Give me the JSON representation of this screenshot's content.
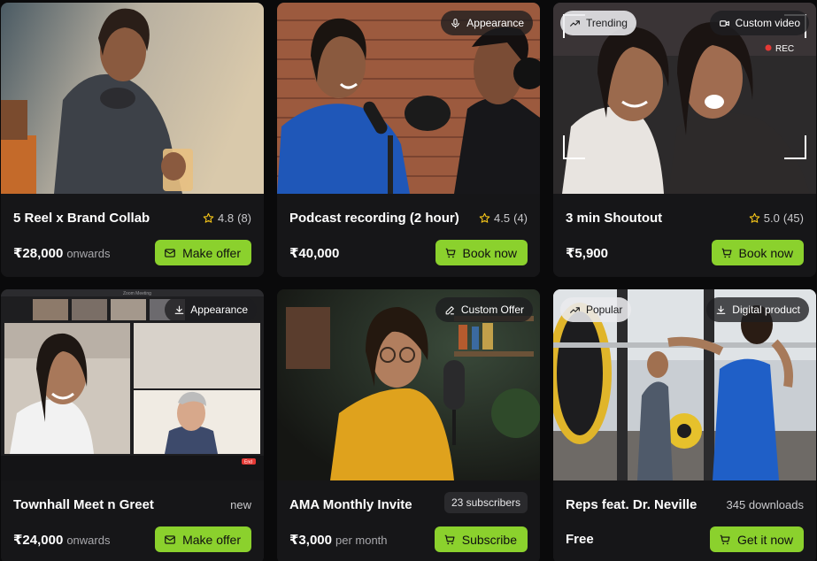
{
  "cards": [
    {
      "title": "5 Reel x Brand Collab",
      "rating": "4.8",
      "rating_count": "(8)",
      "price": "₹28,000",
      "price_suffix": "onwards",
      "cta": "Make offer",
      "cta_icon": "mail-icon"
    },
    {
      "title": "Podcast recording (2 hour)",
      "rating": "4.5",
      "rating_count": "(4)",
      "price": "₹40,000",
      "price_suffix": "",
      "cta": "Book now",
      "cta_icon": "cart-icon",
      "badge_right": "Appearance",
      "badge_right_icon": "mic-icon"
    },
    {
      "title": "3 min Shoutout",
      "rating": "5.0",
      "rating_count": "(45)",
      "price": "₹5,900",
      "price_suffix": "",
      "cta": "Book now",
      "cta_icon": "cart-icon",
      "badge_left": "Trending",
      "badge_left_icon": "trend-icon",
      "badge_right": "Custom video",
      "badge_right_icon": "video-icon",
      "rec_label": "REC"
    },
    {
      "title": "Townhall Meet n Greet",
      "meta": "new",
      "price": "₹24,000",
      "price_suffix": "onwards",
      "cta": "Make offer",
      "cta_icon": "mail-icon",
      "badge_right": "Appearance",
      "badge_right_icon": "download-icon",
      "zoom_title": "Zoom Meeting",
      "zoom_end": "End"
    },
    {
      "title": "AMA Monthly Invite",
      "meta_pill": "23 subscribers",
      "price": "₹3,000",
      "price_suffix": "per month",
      "cta": "Subscribe",
      "cta_icon": "cart-icon",
      "badge_right": "Custom Offer",
      "badge_right_icon": "pen-icon"
    },
    {
      "title": "Reps feat. Dr. Neville",
      "meta": "345 downloads",
      "price": "Free",
      "price_suffix": "",
      "cta": "Get it now",
      "cta_icon": "cart-icon",
      "badge_left": "Popular",
      "badge_left_icon": "trend-icon",
      "badge_right": "Digital product",
      "badge_right_icon": "download-icon"
    }
  ],
  "colors": {
    "accent": "#8bd12d",
    "card_bg": "#161618",
    "page_bg": "#0a0a0b",
    "star": "#f5c518"
  }
}
